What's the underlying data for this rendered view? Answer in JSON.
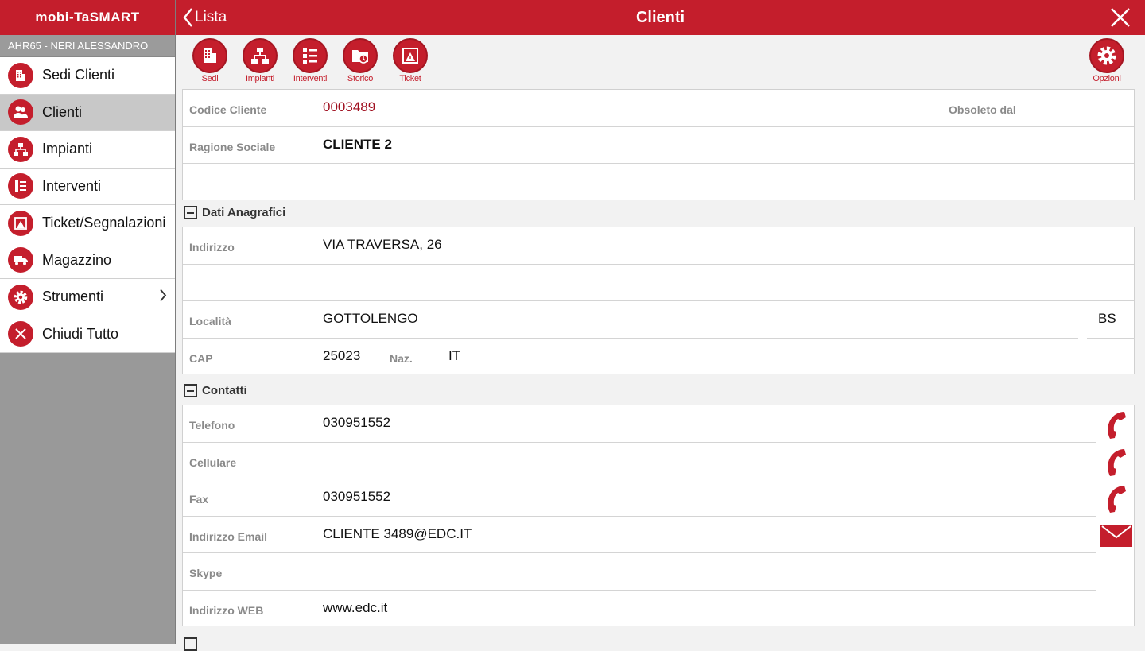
{
  "sidebar": {
    "logo": "mobi-TaSMART",
    "user": "AHR65 - NERI ALESSANDRO",
    "items": [
      {
        "label": "Sedi Clienti"
      },
      {
        "label": "Clienti"
      },
      {
        "label": "Impianti"
      },
      {
        "label": "Interventi"
      },
      {
        "label": "Ticket/Segnalazioni"
      },
      {
        "label": "Magazzino"
      },
      {
        "label": "Strumenti"
      },
      {
        "label": "Chiudi Tutto"
      }
    ]
  },
  "header": {
    "back_label": "Lista",
    "title": "Clienti"
  },
  "toolbar": {
    "sedi": "Sedi",
    "impianti": "Impianti",
    "interventi": "Interventi",
    "storico": "Storico",
    "ticket": "Ticket",
    "opzioni": "Opzioni"
  },
  "cliente": {
    "codice_label": "Codice Cliente",
    "codice_value": "0003489",
    "obsoleto_label": "Obsoleto dal",
    "ragione_label": "Ragione Sociale",
    "ragione_value": "CLIENTE 2"
  },
  "anagrafici": {
    "title": "Dati Anagrafici",
    "indirizzo_label": "Indirizzo",
    "indirizzo_value": "VIA TRAVERSA, 26",
    "localita_label": "Località",
    "localita_value": "GOTTOLENGO",
    "provincia_value": "BS",
    "cap_label": "CAP",
    "cap_value": "25023",
    "naz_label": "Naz.",
    "naz_value": "IT"
  },
  "contatti": {
    "title": "Contatti",
    "telefono_label": "Telefono",
    "telefono_value": "030951552",
    "cellulare_label": "Cellulare",
    "cellulare_value": "",
    "fax_label": "Fax",
    "fax_value": "030951552",
    "email_label": "Indirizzo Email",
    "email_value": "CLIENTE 3489@EDC.IT",
    "skype_label": "Skype",
    "skype_value": "",
    "web_label": "Indirizzo WEB",
    "web_value": "www.edc.it"
  },
  "colors": {
    "accent": "#c41e2c",
    "sidebar_bg": "#999999",
    "active_item": "#c8c8c8"
  }
}
